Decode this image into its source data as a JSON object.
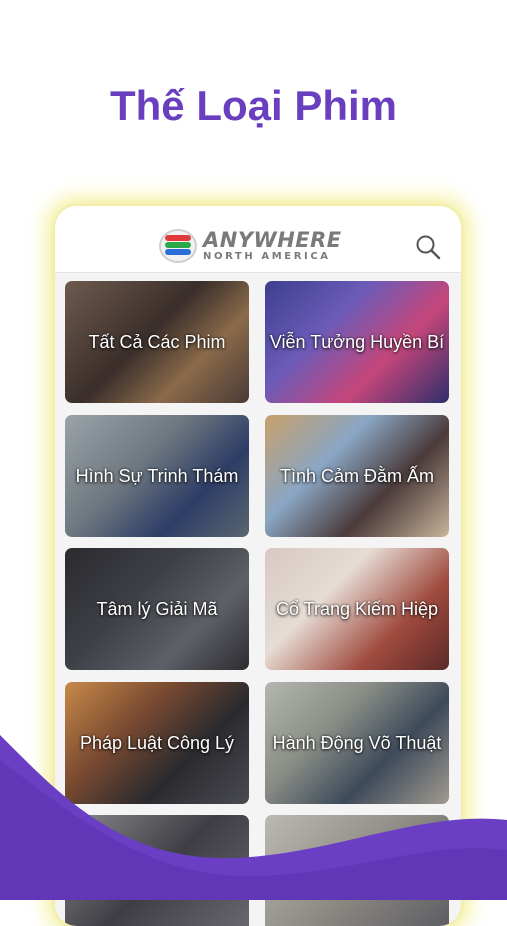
{
  "headline": "Thế Loại Phim",
  "app": {
    "logo_main": "ANYWHERE",
    "logo_sub": "NORTH AMERICA",
    "search_icon": "search-icon"
  },
  "categories": [
    {
      "label": "Tất Cả Các Phim"
    },
    {
      "label": "Viễn Tưởng Huyền Bí"
    },
    {
      "label": "Hình Sự Trinh Thám"
    },
    {
      "label": "Tình Cảm Đằm Ấm"
    },
    {
      "label": "Tâm lý Giải Mã"
    },
    {
      "label": "Cổ Trang Kiếm Hiệp"
    },
    {
      "label": "Pháp Luật Công Lý"
    },
    {
      "label": "Hành Động Võ Thuật"
    },
    {
      "label": ""
    },
    {
      "label": ""
    }
  ],
  "colors": {
    "headline": "#6a3fbf",
    "wave": "#6b3fc4",
    "glow": "#f5f096"
  }
}
